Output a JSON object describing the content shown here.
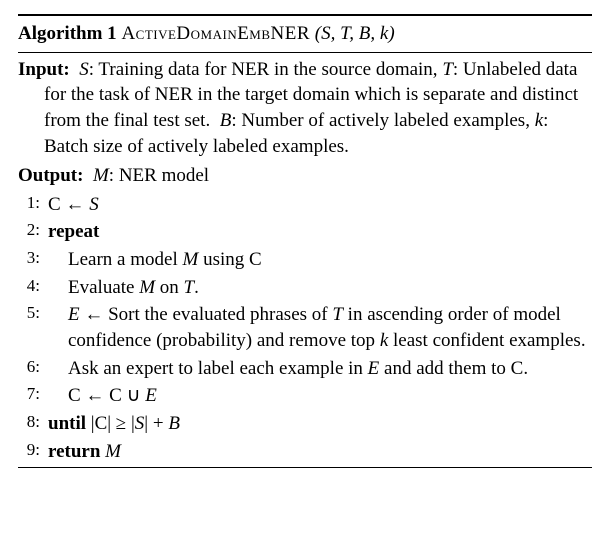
{
  "header": {
    "algo_label": "Algorithm 1",
    "algo_name": "ActiveDomainEmbNER",
    "params": "(S, T, B, k)"
  },
  "input": {
    "label": "Input:",
    "lines": [
      "S: Training data for NER in the source domain, T: Unlabeled data for the task of NER in the target domain which is separate and distinct from the final test set. B: Number of actively labeled examples, k: Batch size of actively labeled examples."
    ]
  },
  "output": {
    "label": "Output:",
    "text": "M: NER model"
  },
  "steps": [
    {
      "n": "1:",
      "indent": false,
      "html": "C ← <span class='italic'>S</span>"
    },
    {
      "n": "2:",
      "indent": false,
      "html": "<span class='bold'>repeat</span>"
    },
    {
      "n": "3:",
      "indent": true,
      "html": "Learn a model <span class='italic'>M</span> using C"
    },
    {
      "n": "4:",
      "indent": true,
      "html": "Evaluate <span class='italic'>M</span> on <span class='italic'>T</span>."
    },
    {
      "n": "5:",
      "indent": true,
      "html": "<span class='italic'>E</span> ← Sort the evaluated phrases of <span class='italic'>T</span> in ascending order of model confidence (probability) and remove top <span class='italic'>k</span> least confident examples."
    },
    {
      "n": "6:",
      "indent": true,
      "html": "Ask an expert to label each example in <span class='italic'>E</span> and add them to C."
    },
    {
      "n": "7:",
      "indent": true,
      "html": "C ← C ∪ <span class='italic'>E</span>"
    },
    {
      "n": "8:",
      "indent": false,
      "html": "<span class='bold'>until</span> |C| ≥ |<span class='italic'>S</span>| + <span class='italic'>B</span>"
    },
    {
      "n": "9:",
      "indent": false,
      "html": "<span class='bold'>return</span> <span class='italic'>M</span>"
    }
  ]
}
